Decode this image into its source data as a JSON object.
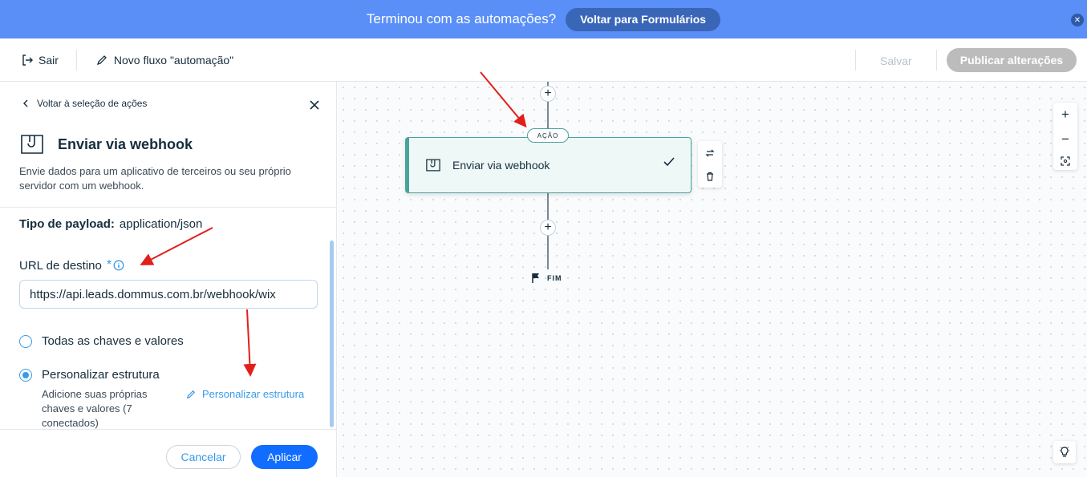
{
  "banner": {
    "text": "Terminou com as automações?",
    "button_label": "Voltar para Formulários",
    "close_glyph": "✕"
  },
  "header": {
    "exit_label": "Sair",
    "flow_name": "Novo fluxo \"automação\"",
    "save_label": "Salvar",
    "publish_label": "Publicar alterações"
  },
  "panel": {
    "back_label": "Voltar à seleção de ações",
    "title": "Enviar via webhook",
    "description": "Envie dados para um aplicativo de terceiros ou seu próprio servidor com um webhook.",
    "payload_label": "Tipo de payload:",
    "payload_value": "application/json",
    "url_label": "URL de destino",
    "required_mark": "*",
    "url_value": "https://api.leads.dommus.com.br/webhook/wix",
    "options": [
      {
        "label": "Todas as chaves e valores",
        "selected": false
      },
      {
        "label": "Personalizar estrutura",
        "selected": true
      }
    ],
    "custom_description": "Adicione suas próprias chaves e valores (7 conectados)",
    "custom_link": "Personalizar estrutura",
    "cancel_label": "Cancelar",
    "apply_label": "Aplicar"
  },
  "canvas": {
    "action_tag": "AÇÃO",
    "action_card_label": "Enviar via webhook",
    "end_label": "FIM",
    "plus_glyph": "+",
    "zoom_in": "+",
    "zoom_out": "−"
  },
  "colors": {
    "banner": "#5a8ff8",
    "primary": "#116dff",
    "accent": "#3899ec",
    "action_border": "#4aa39b",
    "annotation_arrow": "#e0201b"
  },
  "icons": {
    "exit": "exit-icon",
    "edit": "pencil-icon",
    "back": "chevron-left-icon",
    "close": "close-icon",
    "webhook": "webhook-icon",
    "info": "info-icon",
    "check": "check-icon",
    "swap": "swap-icon",
    "delete": "trash-icon",
    "flag": "flag-icon",
    "fit": "fit-screen-icon",
    "bulb": "lightbulb-icon"
  }
}
